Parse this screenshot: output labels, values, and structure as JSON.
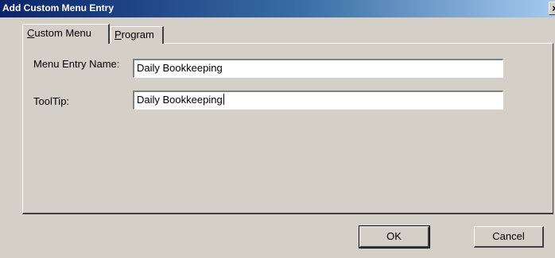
{
  "window": {
    "title": "Add Custom Menu Entry",
    "close_glyph": "×"
  },
  "tabs": [
    {
      "label_first": "C",
      "label_rest": "ustom Menu",
      "active": true
    },
    {
      "label_first": "P",
      "label_rest": "rogram",
      "active": false
    }
  ],
  "form": {
    "menu_entry_name_label": "Menu Entry Name:",
    "menu_entry_name_value": "Daily Bookkeeping",
    "tooltip_label": "ToolTip:",
    "tooltip_value": "Daily Bookkeeping"
  },
  "buttons": {
    "ok": "OK",
    "cancel": "Cancel"
  },
  "colors": {
    "face": "#d4d0c8",
    "title_start": "#0a246a",
    "title_end": "#a6caf0"
  },
  "icons": {
    "close": "close-icon"
  }
}
